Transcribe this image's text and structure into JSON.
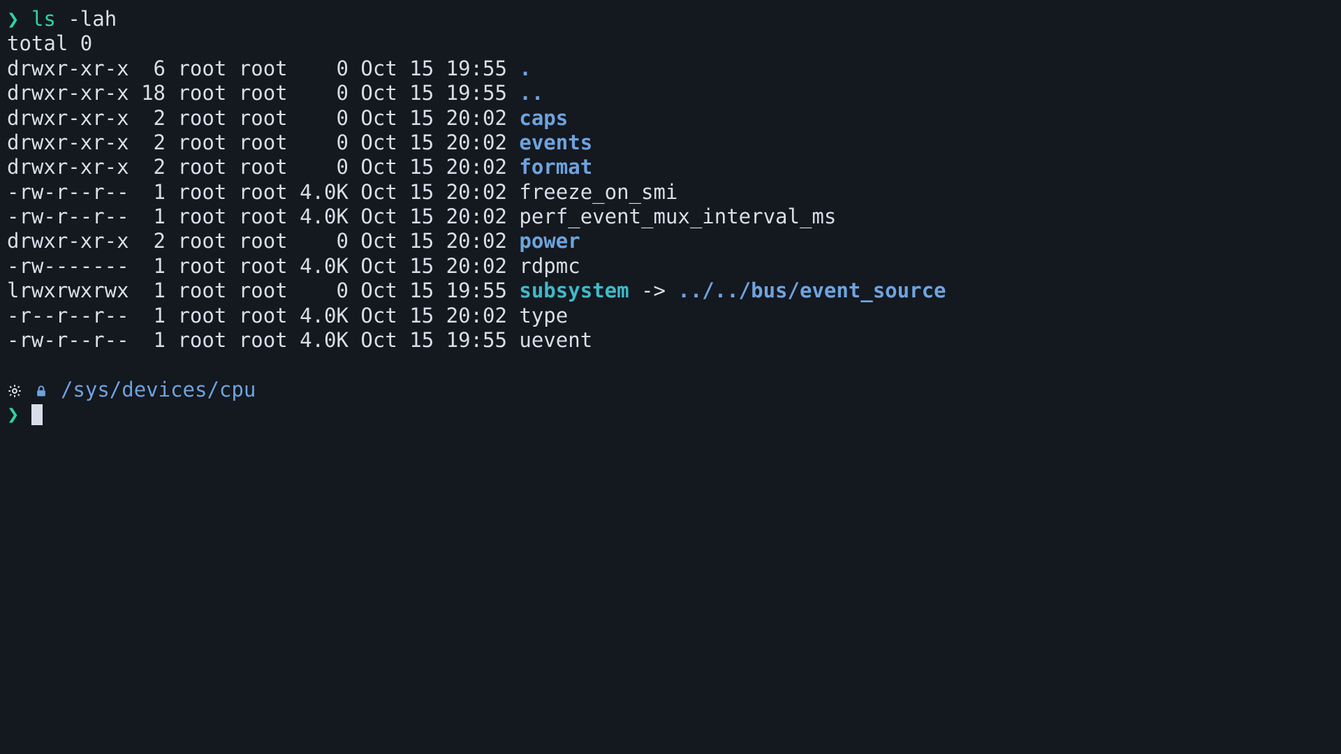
{
  "cmd_line": {
    "prompt": "❯",
    "command": "ls",
    "args": "-lah"
  },
  "total_line": "total 0",
  "entries": [
    {
      "perms": "drwxr-xr-x",
      "links": " 6",
      "owner": "root",
      "group": "root",
      "size": "   0",
      "date": "Oct 15 19:55",
      "name": ".",
      "kind": "dir"
    },
    {
      "perms": "drwxr-xr-x",
      "links": "18",
      "owner": "root",
      "group": "root",
      "size": "   0",
      "date": "Oct 15 19:55",
      "name": "..",
      "kind": "dir"
    },
    {
      "perms": "drwxr-xr-x",
      "links": " 2",
      "owner": "root",
      "group": "root",
      "size": "   0",
      "date": "Oct 15 20:02",
      "name": "caps",
      "kind": "dir"
    },
    {
      "perms": "drwxr-xr-x",
      "links": " 2",
      "owner": "root",
      "group": "root",
      "size": "   0",
      "date": "Oct 15 20:02",
      "name": "events",
      "kind": "dir"
    },
    {
      "perms": "drwxr-xr-x",
      "links": " 2",
      "owner": "root",
      "group": "root",
      "size": "   0",
      "date": "Oct 15 20:02",
      "name": "format",
      "kind": "dir"
    },
    {
      "perms": "-rw-r--r--",
      "links": " 1",
      "owner": "root",
      "group": "root",
      "size": "4.0K",
      "date": "Oct 15 20:02",
      "name": "freeze_on_smi",
      "kind": "file"
    },
    {
      "perms": "-rw-r--r--",
      "links": " 1",
      "owner": "root",
      "group": "root",
      "size": "4.0K",
      "date": "Oct 15 20:02",
      "name": "perf_event_mux_interval_ms",
      "kind": "file"
    },
    {
      "perms": "drwxr-xr-x",
      "links": " 2",
      "owner": "root",
      "group": "root",
      "size": "   0",
      "date": "Oct 15 20:02",
      "name": "power",
      "kind": "dir"
    },
    {
      "perms": "-rw-------",
      "links": " 1",
      "owner": "root",
      "group": "root",
      "size": "4.0K",
      "date": "Oct 15 20:02",
      "name": "rdpmc",
      "kind": "file"
    },
    {
      "perms": "lrwxrwxrwx",
      "links": " 1",
      "owner": "root",
      "group": "root",
      "size": "   0",
      "date": "Oct 15 19:55",
      "name": "subsystem",
      "kind": "symlink",
      "arrow": " -> ",
      "target": "../../bus/event_source"
    },
    {
      "perms": "-r--r--r--",
      "links": " 1",
      "owner": "root",
      "group": "root",
      "size": "4.0K",
      "date": "Oct 15 20:02",
      "name": "type",
      "kind": "file"
    },
    {
      "perms": "-rw-r--r--",
      "links": " 1",
      "owner": "root",
      "group": "root",
      "size": "4.0K",
      "date": "Oct 15 19:55",
      "name": "uevent",
      "kind": "file"
    }
  ],
  "status_line": {
    "cwd": "/sys/devices/cpu"
  },
  "next_prompt": {
    "prompt": "❯"
  }
}
